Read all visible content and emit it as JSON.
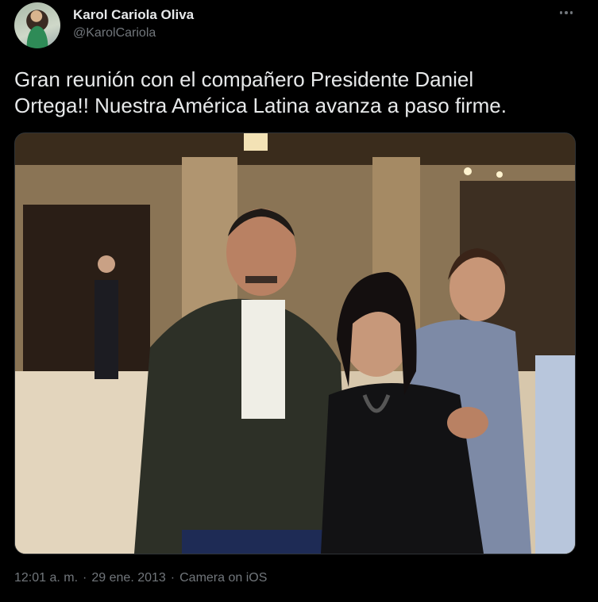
{
  "author": {
    "name": "Karol Cariola Oliva",
    "handle": "@KarolCariola"
  },
  "tweet": {
    "text_line1": "Gran reunión con el compañero Presidente Daniel",
    "text_line2": "Ortega!! Nuestra América Latina avanza a paso firme.",
    "time": "12:01 a. m.",
    "date": "29 ene. 2013",
    "source": "Camera on iOS",
    "separator": "·"
  },
  "colors": {
    "background": "#000000",
    "primary_text": "#e7e9ea",
    "secondary_text": "#71767b"
  },
  "icons": {
    "more": "more-horizontal-icon"
  }
}
